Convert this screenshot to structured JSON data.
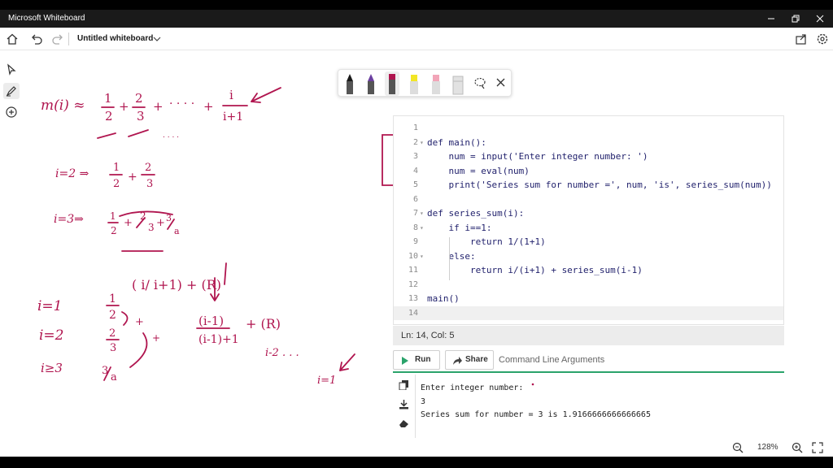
{
  "window": {
    "title": "Microsoft Whiteboard",
    "controls": [
      "minimize",
      "restore",
      "close"
    ]
  },
  "toolbar": {
    "document_title": "Untitled whiteboard",
    "icons": [
      "home-icon",
      "undo-icon",
      "redo-icon",
      "chevron-down-icon",
      "share-icon",
      "settings-icon"
    ]
  },
  "left_rail": {
    "tools": [
      "select-icon",
      "pen-icon",
      "add-icon"
    ],
    "active": "pen-icon"
  },
  "pen_tray": {
    "pens": [
      {
        "name": "black-pen",
        "color": "#1a1a1a"
      },
      {
        "name": "purple-pen",
        "color": "#6b3fa0"
      },
      {
        "name": "magenta-pen",
        "color": "#b0154f"
      },
      {
        "name": "yellow-highlighter",
        "color": "#f2e626"
      },
      {
        "name": "pink-highlighter",
        "color": "#f2a5b8"
      },
      {
        "name": "eraser",
        "color": "#d8d8d8"
      }
    ],
    "selected": "magenta-pen",
    "extra_icons": [
      "lasso-icon",
      "close-icon"
    ]
  },
  "ink_color": "#b0154f",
  "code": {
    "lines": [
      {
        "num": "1",
        "fold": "",
        "text": ""
      },
      {
        "num": "2",
        "fold": "▾",
        "text": "def main():"
      },
      {
        "num": "3",
        "fold": "",
        "text": "    num = input('Enter integer number: ')"
      },
      {
        "num": "4",
        "fold": "",
        "text": "    num = eval(num)"
      },
      {
        "num": "5",
        "fold": "",
        "text": "    print('Series sum for number =', num, 'is', series_sum(num))"
      },
      {
        "num": "6",
        "fold": "",
        "text": ""
      },
      {
        "num": "7",
        "fold": "▾",
        "text": "def series_sum(i):"
      },
      {
        "num": "8",
        "fold": "▾",
        "text": "    if i==1:"
      },
      {
        "num": "9",
        "fold": "",
        "text": "        return 1/(1+1)"
      },
      {
        "num": "10",
        "fold": "▾",
        "text": "    else:"
      },
      {
        "num": "11",
        "fold": "",
        "text": "        return i/(i+1) + series_sum(i-1)"
      },
      {
        "num": "12",
        "fold": "",
        "text": ""
      },
      {
        "num": "13",
        "fold": "",
        "text": "main()"
      },
      {
        "num": "14",
        "fold": "",
        "text": ""
      }
    ],
    "current_line": "14"
  },
  "status": {
    "cursor": "Ln: 14,  Col: 5"
  },
  "actions": {
    "run_label": "Run",
    "share_label": "Share",
    "cmd_placeholder": "Command Line Arguments"
  },
  "console": {
    "lines": [
      "Enter integer number:",
      "3",
      "Series sum for number = 3 is 1.9166666666666665"
    ],
    "tools": [
      "copy-icon",
      "download-icon",
      "clear-icon"
    ]
  },
  "zoom": {
    "level": "128%"
  }
}
